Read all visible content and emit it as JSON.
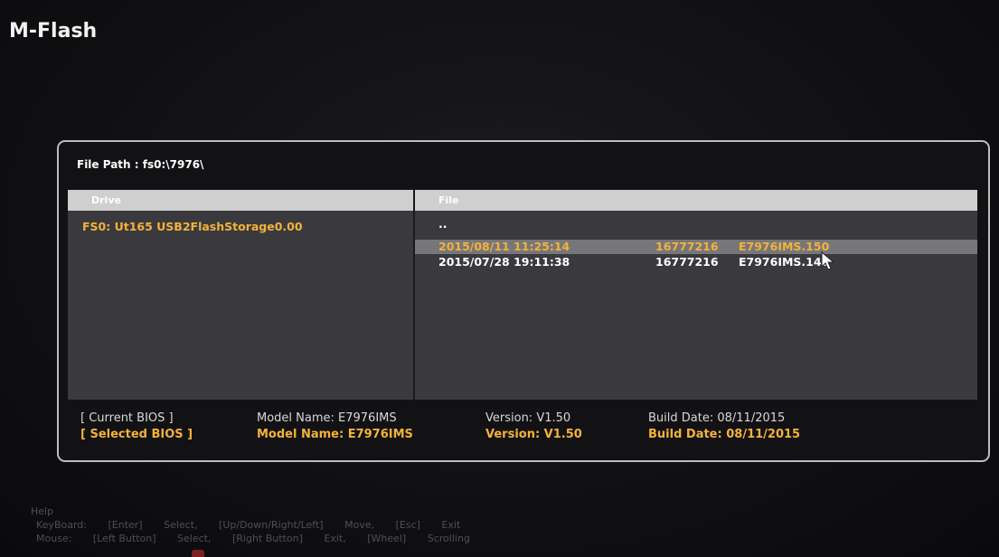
{
  "app": {
    "title": "M-Flash"
  },
  "file_path": {
    "label": "File Path : fs0:\\7976\\"
  },
  "drive_panel": {
    "header": "Drive",
    "items": [
      {
        "label": "FS0: Ut165 USB2FlashStorage0.00"
      }
    ]
  },
  "file_panel": {
    "header": "File",
    "parent_entry": "..",
    "files": [
      {
        "datetime": "2015/08/11 11:25:14",
        "size": "16777216",
        "name": "E7976IMS.150",
        "selected": true
      },
      {
        "datetime": "2015/07/28 19:11:38",
        "size": "16777216",
        "name": "E7976IMS.140",
        "selected": false
      }
    ]
  },
  "bios_info": {
    "current": {
      "tag": "[ Current BIOS  ]",
      "model": "Model Name: E7976IMS",
      "version": "Version: V1.50",
      "build": "Build Date: 08/11/2015"
    },
    "selected": {
      "tag": "[ Selected BIOS ]",
      "model": "Model Name: E7976IMS",
      "version": "Version: V1.50",
      "build": "Build Date: 08/11/2015"
    }
  },
  "help": {
    "title": "Help",
    "keyboard": {
      "device": "KeyBoard:",
      "enter": "[Enter]",
      "enter_action": "Select,",
      "arrows": "[Up/Down/Right/Left]",
      "arrows_action": "Move,",
      "esc": "[Esc]",
      "esc_action": "Exit"
    },
    "mouse": {
      "device": "Mouse:",
      "left": "[Left Button]",
      "left_action": "Select,",
      "right": "[Right Button]",
      "right_action": "Exit,",
      "wheel": "[Wheel]",
      "wheel_action": "Scrolling"
    }
  },
  "colors": {
    "accent_orange": "#f4b23a",
    "panel_border": "#bdbdbd",
    "grid_bg": "#3a3a3e",
    "selection_bg": "#77777a",
    "header_bg": "#cfcfcf"
  }
}
